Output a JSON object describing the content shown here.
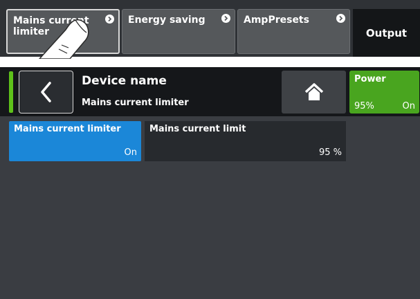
{
  "tabs": [
    {
      "label": "Mains current limiter",
      "active": true
    },
    {
      "label": "Energy saving",
      "active": false
    },
    {
      "label": "AmpPresets",
      "active": false
    }
  ],
  "output_label": "Output",
  "header": {
    "title": "Device name",
    "subtitle": "Mains current limiter"
  },
  "power": {
    "title": "Power",
    "level": "95%",
    "state": "On"
  },
  "cells": [
    {
      "label": "Mains current limiter",
      "value": "On"
    },
    {
      "label": "Mains current limit",
      "value": "95 %"
    }
  ],
  "colors": {
    "accent_blue": "#1b87d8",
    "power_green": "#49a51f",
    "indicator_green": "#5ec11a"
  },
  "icons": [
    "chevron-right-circle-icon",
    "back-arrow-icon",
    "home-icon",
    "hand-pointer-icon"
  ]
}
